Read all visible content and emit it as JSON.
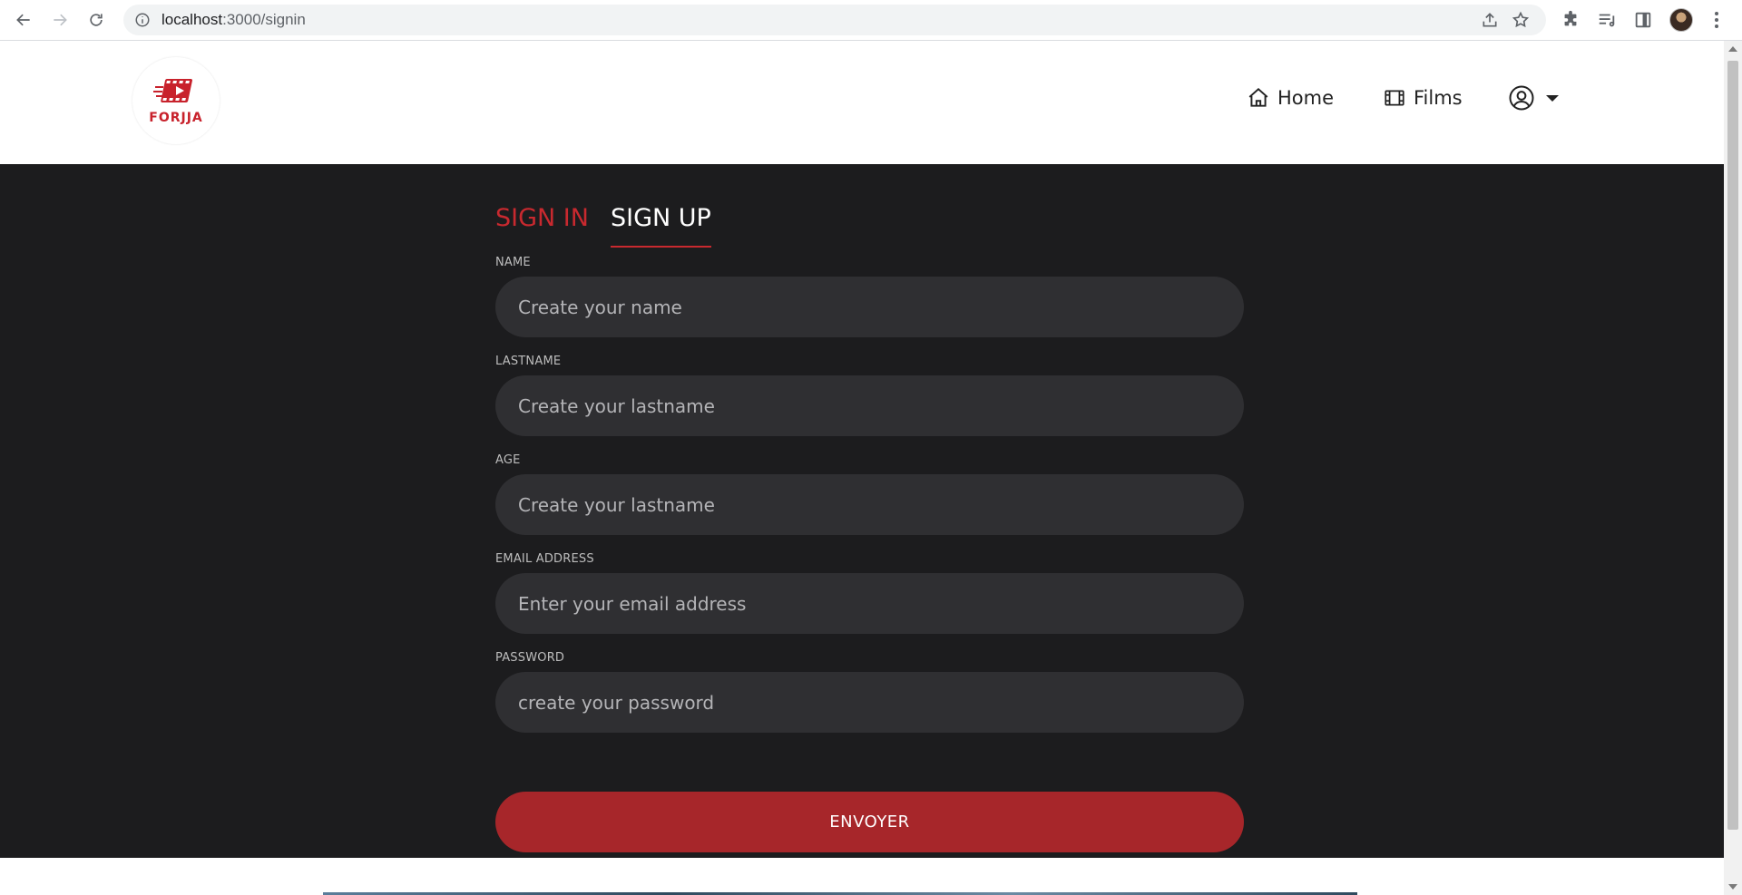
{
  "browser": {
    "url_host": "localhost",
    "url_path": ":3000/signin"
  },
  "site": {
    "logo_text": "FORJJA",
    "nav": {
      "home_label": "Home",
      "films_label": "Films"
    }
  },
  "form": {
    "tabs": {
      "signin_label": "SIGN IN",
      "signup_label": "SIGN UP",
      "active": "SIGN UP"
    },
    "fields": [
      {
        "label": "NAME",
        "placeholder": "Create your name",
        "value": ""
      },
      {
        "label": "LASTNAME",
        "placeholder": "Create your lastname",
        "value": ""
      },
      {
        "label": "AGE",
        "placeholder": "Create your lastname",
        "value": ""
      },
      {
        "label": "EMAIL ADDRESS",
        "placeholder": "Enter your email address",
        "value": ""
      },
      {
        "label": "PASSWORD",
        "placeholder": "create your password",
        "value": ""
      }
    ],
    "submit_label": "ENVOYER"
  },
  "colors": {
    "accent_red": "#c8292f",
    "button_red": "#a7262a",
    "background_dark": "#1c1c1e",
    "input_bg": "#2f2f32"
  }
}
